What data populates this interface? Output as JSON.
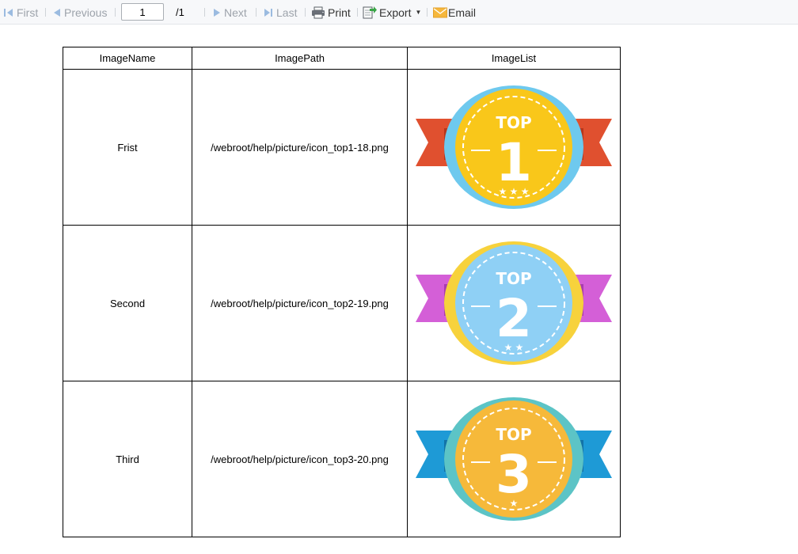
{
  "toolbar": {
    "first_label": "First",
    "previous_label": "Previous",
    "page_value": "1",
    "page_total": "/1",
    "next_label": "Next",
    "last_label": "Last",
    "print_label": "Print",
    "export_label": "Export",
    "email_label": "Email"
  },
  "table": {
    "headers": [
      "ImageName",
      "ImagePath",
      "ImageList"
    ],
    "rows": [
      {
        "name": "Frist",
        "path": "/webroot/help/picture/icon_top1-18.png",
        "badge": {
          "top": "TOP",
          "number": "1"
        }
      },
      {
        "name": "Second",
        "path": "/webroot/help/picture/icon_top2-19.png",
        "badge": {
          "top": "TOP",
          "number": "2"
        }
      },
      {
        "name": "Third",
        "path": "/webroot/help/picture/icon_top3-20.png",
        "badge": {
          "top": "TOP",
          "number": "3"
        }
      }
    ]
  },
  "colors": {
    "badge1": {
      "ribbon": "#e0502f",
      "ribbon_dark": "#b8361b",
      "ring": "#6ec9ee",
      "medal": "#f9c71a"
    },
    "badge2": {
      "ribbon": "#d45fd7",
      "ribbon_dark": "#a93cb0",
      "ring": "#f7d23c",
      "medal": "#8fd0f5"
    },
    "badge3": {
      "ribbon": "#1e9ad6",
      "ribbon_dark": "#1273a8",
      "ring": "#5cc4c6",
      "medal": "#f6b93a"
    }
  }
}
